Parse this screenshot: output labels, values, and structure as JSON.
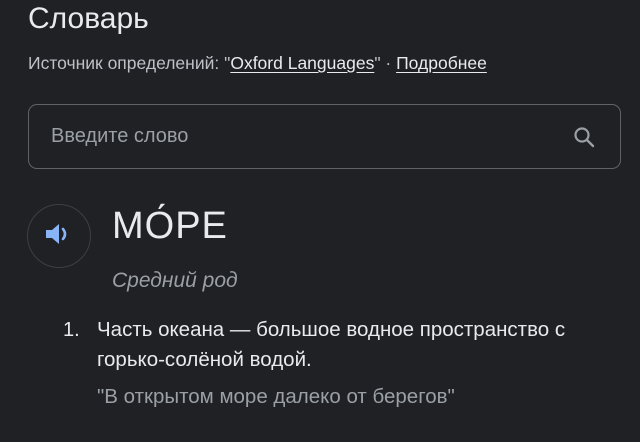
{
  "header": {
    "title": "Словарь",
    "source_prefix": "Источник определений: \"",
    "source_name": "Oxford Languages",
    "source_suffix": "\" · ",
    "more_link": "Подробнее"
  },
  "search": {
    "placeholder": "Введите слово",
    "value": ""
  },
  "entry": {
    "word": "МО́РЕ",
    "part_of_speech": "Средний род",
    "senses": [
      {
        "number": "1.",
        "definition": "Часть океана — большое водное пространство с горько-солёной водой.",
        "example": "\"В открытом море далеко от берегов\""
      }
    ]
  },
  "icons": {
    "search": "search-icon",
    "speaker": "speaker-icon"
  },
  "colors": {
    "background": "#202124",
    "text": "#e8eaed",
    "muted": "#9aa0a6",
    "speaker_accent": "#8ab4f8"
  }
}
